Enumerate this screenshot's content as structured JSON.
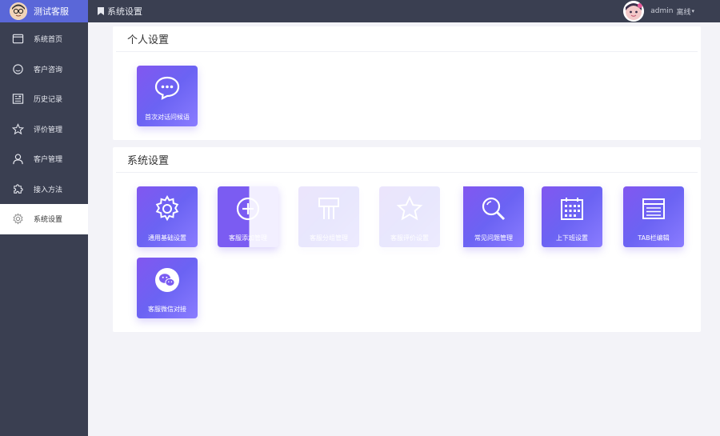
{
  "brand": {
    "title": "测试客服",
    "avatar_icon": "glasses-man-avatar-icon"
  },
  "sidebar": {
    "items": [
      {
        "label": "系统首页",
        "icon": "window-icon",
        "active": false
      },
      {
        "label": "客户咨询",
        "icon": "chat-circle-icon",
        "active": false
      },
      {
        "label": "历史记录",
        "icon": "document-list-icon",
        "active": false
      },
      {
        "label": "评价管理",
        "icon": "star-icon",
        "active": false
      },
      {
        "label": "客户管理",
        "icon": "user-icon",
        "active": false
      },
      {
        "label": "接入方法",
        "icon": "puzzle-icon",
        "active": false
      },
      {
        "label": "系统设置",
        "icon": "gear-icon",
        "active": true
      }
    ]
  },
  "topbar": {
    "breadcrumb": "系统设置",
    "user_name": "admin",
    "user_status": "离线"
  },
  "personal": {
    "title": "个人设置",
    "tiles": [
      {
        "label": "首次对话问候语",
        "icon": "chat-bubble-icon"
      }
    ]
  },
  "system": {
    "title": "系统设置",
    "tiles": [
      {
        "label": "通用基础设置",
        "icon": "gear-icon"
      },
      {
        "label": "客服添加管理",
        "icon": "plus-circle-icon"
      },
      {
        "label": "客服分组管理",
        "icon": "columns-icon"
      },
      {
        "label": "客服评价设置",
        "icon": "star-icon"
      },
      {
        "label": "常见问题管理",
        "icon": "magnifier-icon"
      },
      {
        "label": "上下班设置",
        "icon": "calendar-icon"
      },
      {
        "label": "TAB栏编辑",
        "icon": "browser-window-icon"
      },
      {
        "label": "客服微信对接",
        "icon": "wechat-icon"
      }
    ]
  },
  "colors": {
    "sidebar_bg": "#3a3f51",
    "brand_bg": "#5a67d8",
    "tile_gradient_start": "#8257f0",
    "tile_gradient_end": "#8a7cff"
  }
}
